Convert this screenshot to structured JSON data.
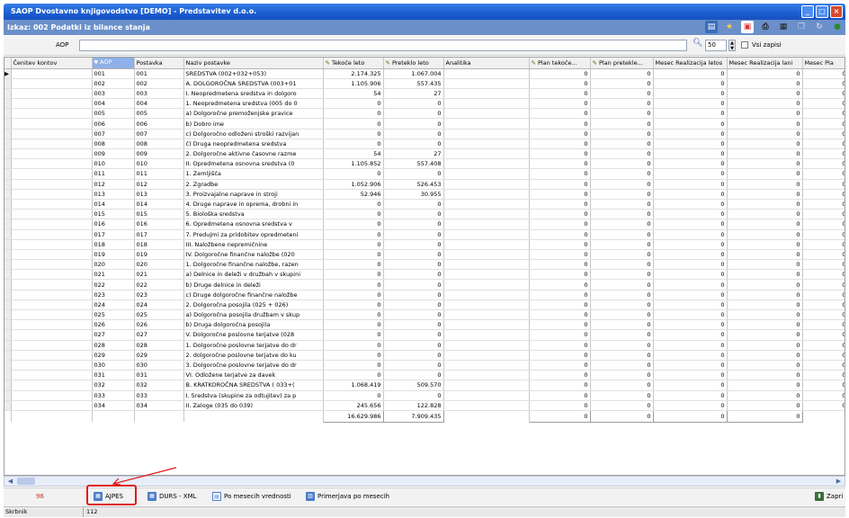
{
  "window": {
    "title": "SAOP Dvostavno knjigovodstvo [DEMO] - Predstavitev d.o.o.",
    "report_title": "Izkaz: 002 Podatki iz bilance stanja"
  },
  "filter": {
    "label": "AOP",
    "value": "",
    "page_size": "50",
    "all_records_label": "Vsi zapisi"
  },
  "columns": [
    "Čenitev kontov",
    "AOP",
    "Postavka",
    "Naziv postavke",
    "Tekoče leto",
    "Preteklo leto",
    "Analitika",
    "Plan tekoče...",
    "Plan pretekle...",
    "Mesec Realizacija letos",
    "Mesec Realizacija lani",
    "Mesec Pla"
  ],
  "rows": [
    {
      "aop": "001",
      "postavka": "001",
      "naziv": "SREDSTVA (002+032+053)",
      "tekoce": "2.174.325",
      "preteklo": "1.067.004"
    },
    {
      "aop": "002",
      "postavka": "002",
      "naziv": "A. DOLGOROČNA SREDSTVA (003+01",
      "tekoce": "1.105.906",
      "preteklo": "557.435"
    },
    {
      "aop": "003",
      "postavka": "003",
      "naziv": "I. Neopredmetena sredstva in dolgoro",
      "tekoce": "54",
      "preteklo": "27"
    },
    {
      "aop": "004",
      "postavka": "004",
      "naziv": "1. Neopredmetena sredstva (005 do 0",
      "tekoce": "0",
      "preteklo": "0"
    },
    {
      "aop": "005",
      "postavka": "005",
      "naziv": "a) Dolgoročne premoženjske pravice",
      "tekoce": "0",
      "preteklo": "0"
    },
    {
      "aop": "006",
      "postavka": "006",
      "naziv": "b) Dobro ime",
      "tekoce": "0",
      "preteklo": "0"
    },
    {
      "aop": "007",
      "postavka": "007",
      "naziv": "c) Dolgoročno odloženi stroški razvijan",
      "tekoce": "0",
      "preteklo": "0"
    },
    {
      "aop": "008",
      "postavka": "008",
      "naziv": "č) Druga neopredmetena sredstva",
      "tekoce": "0",
      "preteklo": "0"
    },
    {
      "aop": "009",
      "postavka": "009",
      "naziv": "2. Dolgoročne aktivne časovne razme",
      "tekoce": "54",
      "preteklo": "27"
    },
    {
      "aop": "010",
      "postavka": "010",
      "naziv": "II. Opredmetena osnovna sredstva (0",
      "tekoce": "1.105.852",
      "preteklo": "557.408"
    },
    {
      "aop": "011",
      "postavka": "011",
      "naziv": "1. Zemljišča",
      "tekoce": "0",
      "preteklo": "0"
    },
    {
      "aop": "012",
      "postavka": "012",
      "naziv": "2. Zgradbe",
      "tekoce": "1.052.906",
      "preteklo": "526.453"
    },
    {
      "aop": "013",
      "postavka": "013",
      "naziv": "3. Proizvajalne naprave in stroji",
      "tekoce": "52.946",
      "preteklo": "30.955"
    },
    {
      "aop": "014",
      "postavka": "014",
      "naziv": "4. Druge naprave in oprema, drobni in",
      "tekoce": "0",
      "preteklo": "0"
    },
    {
      "aop": "015",
      "postavka": "015",
      "naziv": "5. Biološka sredstva",
      "tekoce": "0",
      "preteklo": "0"
    },
    {
      "aop": "016",
      "postavka": "016",
      "naziv": "6. Opredmetena osnovna sredstva v",
      "tekoce": "0",
      "preteklo": "0"
    },
    {
      "aop": "017",
      "postavka": "017",
      "naziv": "7. Predujmi za pridobitev opredmeteni",
      "tekoce": "0",
      "preteklo": "0"
    },
    {
      "aop": "018",
      "postavka": "018",
      "naziv": "III. Naložbene nepremičnine",
      "tekoce": "0",
      "preteklo": "0"
    },
    {
      "aop": "019",
      "postavka": "019",
      "naziv": "IV. Dolgoročne finančne naložbe (020",
      "tekoce": "0",
      "preteklo": "0"
    },
    {
      "aop": "020",
      "postavka": "020",
      "naziv": "1. Dolgoročne finančne naložbe, razen",
      "tekoce": "0",
      "preteklo": "0"
    },
    {
      "aop": "021",
      "postavka": "021",
      "naziv": "a) Delnice in deleži v družbah v skupini",
      "tekoce": "0",
      "preteklo": "0"
    },
    {
      "aop": "022",
      "postavka": "022",
      "naziv": "b) Druge delnice in deleži",
      "tekoce": "0",
      "preteklo": "0"
    },
    {
      "aop": "023",
      "postavka": "023",
      "naziv": "c) Druge dolgoročne finančne naložbe",
      "tekoce": "0",
      "preteklo": "0"
    },
    {
      "aop": "024",
      "postavka": "024",
      "naziv": "2. Dolgoročna posojila (025 + 026)",
      "tekoce": "0",
      "preteklo": "0"
    },
    {
      "aop": "025",
      "postavka": "025",
      "naziv": "a) Dolgoročna posojila družbam v skup",
      "tekoce": "0",
      "preteklo": "0"
    },
    {
      "aop": "026",
      "postavka": "026",
      "naziv": "b) Druga dolgoročna posojila",
      "tekoce": "0",
      "preteklo": "0"
    },
    {
      "aop": "027",
      "postavka": "027",
      "naziv": "V. Dolgoročne poslovne terjatve (028",
      "tekoce": "0",
      "preteklo": "0"
    },
    {
      "aop": "028",
      "postavka": "028",
      "naziv": "1. Dolgoročne poslovne terjatve do dr",
      "tekoce": "0",
      "preteklo": "0"
    },
    {
      "aop": "029",
      "postavka": "029",
      "naziv": "2. dolgoročne poslovne terjatve do ku",
      "tekoce": "0",
      "preteklo": "0"
    },
    {
      "aop": "030",
      "postavka": "030",
      "naziv": "3. Dolgoročne poslovne terjatve do dr",
      "tekoce": "0",
      "preteklo": "0"
    },
    {
      "aop": "031",
      "postavka": "031",
      "naziv": "VI. Odložene terjatve za davek",
      "tekoce": "0",
      "preteklo": "0"
    },
    {
      "aop": "032",
      "postavka": "032",
      "naziv": "B. KRATKOROČNA SREDSTVA ( 033+(",
      "tekoce": "1.068.419",
      "preteklo": "509.570"
    },
    {
      "aop": "033",
      "postavka": "033",
      "naziv": "I. Sredstva (skupine za odtujitev) za p",
      "tekoce": "0",
      "preteklo": "0"
    },
    {
      "aop": "034",
      "postavka": "034",
      "naziv": "II. Zaloge (035 do 039)",
      "tekoce": "245.656",
      "preteklo": "122.828"
    }
  ],
  "plan_value": "0",
  "totals": {
    "tekoce": "16.629.986",
    "preteklo": "7.909.435",
    "plan_tekoce": "0",
    "plan_pretekle": "0",
    "mesec_letos": "0",
    "mesec_lani": "0"
  },
  "bottom": {
    "record_count": "96",
    "ajpes_label": "AJPES",
    "durs_label": "DURS - XML",
    "po_mesecih_label": "Po mesecih vrednosti",
    "primerjava_label": "Primerjava po mesecih",
    "zapri_label": "Zapri"
  },
  "status": {
    "left": "Skrbnik",
    "right": "112"
  },
  "colors": {
    "title_blue": "#1c5fd3",
    "subbar_blue": "#6b8fc9",
    "highlight_red": "#e01818",
    "aop_header": "#8fb0e8"
  }
}
